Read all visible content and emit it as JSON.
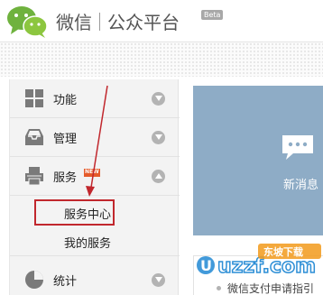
{
  "header": {
    "brand_name": "微信",
    "brand_sub": "公众平台",
    "beta_label": "Beta"
  },
  "sidebar": {
    "items": [
      {
        "label": "功能",
        "icon": "grid-icon"
      },
      {
        "label": "管理",
        "icon": "inbox-icon"
      },
      {
        "label": "服务",
        "icon": "printer-icon",
        "badge": "NEW"
      },
      {
        "label": "统计",
        "icon": "pie-chart-icon"
      }
    ],
    "sub_items": [
      {
        "label": "服务中心"
      },
      {
        "label": "我的服务"
      }
    ]
  },
  "main": {
    "message_label": "新消息",
    "notice_text": "微信支付申请指引"
  },
  "watermark": {
    "text": "uzzf.com",
    "badge": "东坡下载"
  },
  "colors": {
    "accent_blue": "#8eacc6",
    "highlight_red": "#c1272d",
    "sidebar_bg": "#f3f3f3",
    "badge_orange": "#e55b2b"
  }
}
